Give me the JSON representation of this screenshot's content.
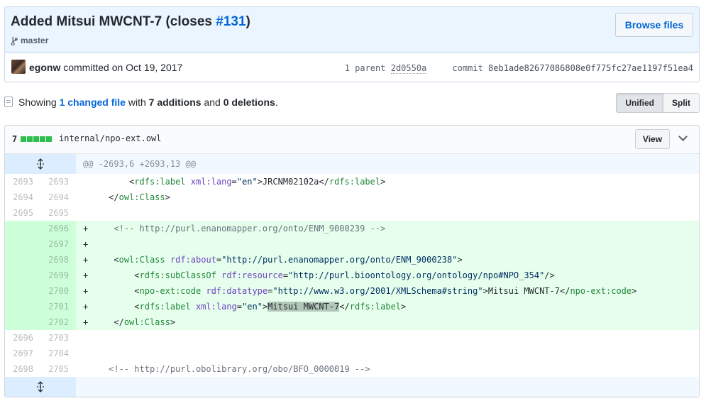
{
  "commit": {
    "title_text": "Added Mitsui MWCNT-7 (closes ",
    "issue_link": "#131",
    "title_close": ")",
    "branch": "master",
    "browse_label": "Browse files",
    "author": "egonw",
    "committed_text": "committed on Oct 19, 2017",
    "parent_label": "1 parent",
    "parent_sha": "2d0550a",
    "commit_label": "commit",
    "commit_sha": "8eb1ade82677086808e0f775fc27ae1197f51ea4"
  },
  "toc": {
    "showing": "Showing ",
    "changed": "1 changed file",
    "with": " with ",
    "additions": "7 additions",
    "and": " and ",
    "deletions": "0 deletions",
    "period": ".",
    "unified_label": "Unified",
    "split_label": "Split"
  },
  "file": {
    "diffstat_count": "7",
    "path": "internal/npo-ext.owl",
    "view_label": "View",
    "hunk_header": "@@ -2693,6 +2693,13 @@"
  },
  "lines": [
    {
      "old": "2693",
      "new": "2693",
      "type": "ctx"
    },
    {
      "old": "2694",
      "new": "2694",
      "type": "ctx"
    },
    {
      "old": "2695",
      "new": "2695",
      "type": "ctx"
    },
    {
      "old": "",
      "new": "2696",
      "type": "add"
    },
    {
      "old": "",
      "new": "2697",
      "type": "add"
    },
    {
      "old": "",
      "new": "2698",
      "type": "add"
    },
    {
      "old": "",
      "new": "2699",
      "type": "add"
    },
    {
      "old": "",
      "new": "2700",
      "type": "add"
    },
    {
      "old": "",
      "new": "2701",
      "type": "add"
    },
    {
      "old": "",
      "new": "2702",
      "type": "add"
    },
    {
      "old": "2696",
      "new": "2703",
      "type": "ctx"
    },
    {
      "old": "2697",
      "new": "2704",
      "type": "ctx"
    },
    {
      "old": "2698",
      "new": "2705",
      "type": "ctx"
    }
  ],
  "code": {
    "l1": {
      "indent": "        ",
      "open": "<",
      "tag": "rdfs:label",
      "attr": "xml:lang",
      "eq": "=",
      "val": "\"en\"",
      "gt": ">",
      "text": "JRCNM02102a",
      "close_open": "</",
      "close_tag": "rdfs:label",
      "close_gt": ">"
    },
    "l2": {
      "indent": "    ",
      "open": "</",
      "tag": "owl:Class",
      "gt": ">"
    },
    "l3": {
      "text": ""
    },
    "l4": {
      "sign": "+",
      "indent": "    ",
      "comment": "<!-- http://purl.enanomapper.org/onto/ENM_9000239 -->"
    },
    "l5": {
      "sign": "+",
      "text": ""
    },
    "l6": {
      "sign": "+",
      "indent": "    ",
      "open": "<",
      "tag": "owl:Class",
      "attr": "rdf:about",
      "eq": "=",
      "val": "\"http://purl.enanomapper.org/onto/ENM_9000238\"",
      "gt": ">"
    },
    "l7": {
      "sign": "+",
      "indent": "        ",
      "open": "<",
      "tag": "rdfs:subClassOf",
      "attr": "rdf:resource",
      "eq": "=",
      "val": "\"http://purl.bioontology.org/ontology/npo#NPO_354\"",
      "gt": "/>"
    },
    "l8": {
      "sign": "+",
      "indent": "        ",
      "open": "<",
      "tag": "npo-ext:code",
      "attr": "rdf:datatype",
      "eq": "=",
      "val": "\"http://www.w3.org/2001/XMLSchema#string\"",
      "gt": ">",
      "text": "Mitsui MWCNT-7",
      "close_open": "</",
      "close_tag": "npo-ext:code",
      "close_gt": ">"
    },
    "l9": {
      "sign": "+",
      "indent": "        ",
      "open": "<",
      "tag": "rdfs:label",
      "attr": "xml:lang",
      "eq": "=",
      "val": "\"en\"",
      "gt": ">",
      "text": "Mitsui MWCNT-7",
      "close_open": "</",
      "close_tag": "rdfs:label",
      "close_gt": ">"
    },
    "l10": {
      "sign": "+",
      "indent": "    ",
      "open": "</",
      "tag": "owl:Class",
      "gt": ">"
    },
    "l11": {
      "text": ""
    },
    "l12": {
      "text": ""
    },
    "l13": {
      "indent": "    ",
      "comment": "<!-- http://purl.obolibrary.org/obo/BFO_0000019 -->"
    }
  }
}
